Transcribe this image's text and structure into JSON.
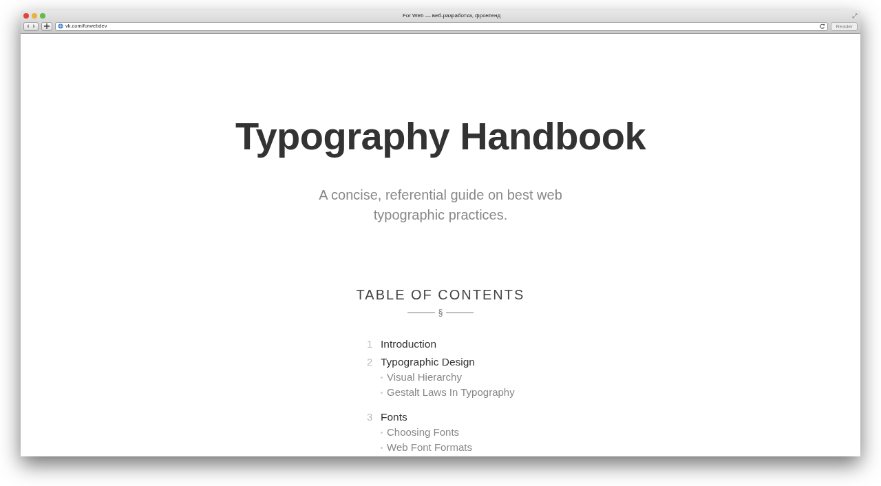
{
  "window": {
    "title": "For Web — веб-разработка, фронтенд",
    "url": "vk.com/forwebdev",
    "reader_button": {
      "label": "Reader",
      "disabled": true
    }
  },
  "page": {
    "title": "Typography Handbook",
    "subtitle": "A concise, referential guide on best web typographic practices.",
    "toc": {
      "heading": "TABLE OF CONTENTS",
      "ornament": "§",
      "sections": [
        {
          "number": "1",
          "label": "Introduction"
        },
        {
          "number": "2",
          "label": "Typographic Design",
          "children": [
            {
              "label": "Visual Hierarchy"
            },
            {
              "label": "Gestalt Laws In Typography"
            }
          ]
        },
        {
          "number": "3",
          "label": "Fonts",
          "children": [
            {
              "label": "Choosing Fonts"
            },
            {
              "label": "Web Font Formats"
            }
          ]
        }
      ]
    }
  }
}
